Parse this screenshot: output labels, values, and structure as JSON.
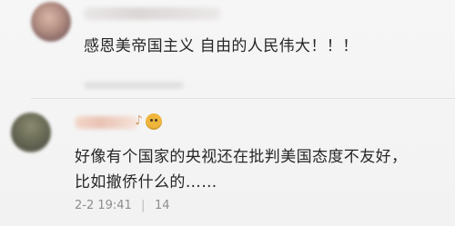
{
  "comments": [
    {
      "author_blurred": true,
      "text": "感恩美帝国主义  自由的人民伟大！！！"
    },
    {
      "author_blurred": true,
      "author_suffix": "♪",
      "text_line_1": "好像有个国家的央视还在批判美国态度不友好，",
      "text_line_2": "比如撤侨什么的……",
      "timestamp": "2-2 19:41",
      "separator": "|",
      "reply_count": "14"
    }
  ]
}
